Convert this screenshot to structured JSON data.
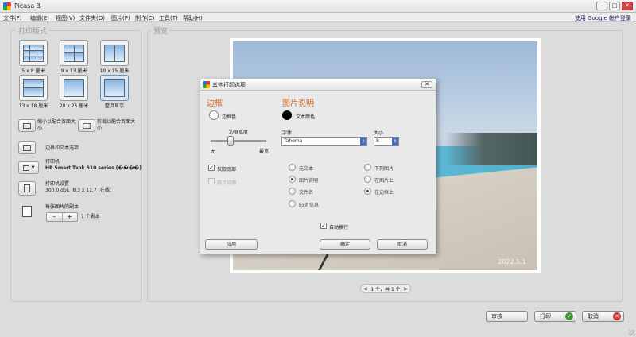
{
  "app": {
    "title": "Picasa 3"
  },
  "window_controls": {
    "minimize": "–",
    "maximize": "□",
    "close": "✕"
  },
  "menu": {
    "items": [
      "文件(F)",
      "编辑(E)",
      "视图(V)",
      "文件夹(O)",
      "图片(P)",
      "制作(C)",
      "工具(T)",
      "帮助(H)"
    ],
    "signin": "使用 Google 帐户登录"
  },
  "left": {
    "section_title": "打印版式",
    "layouts": [
      {
        "label": "5 x 8 厘米"
      },
      {
        "label": "9 x 13 厘米"
      },
      {
        "label": "10 x 15 厘米"
      },
      {
        "label": "13 x 18 厘米"
      },
      {
        "label": "20 x 25 厘米"
      },
      {
        "label": "整页显示"
      }
    ],
    "fit": {
      "shrink_label": "缩小以配合页面大小",
      "crop_label": "剪裁以配合页面大小"
    },
    "border_text": "边界和文本选项",
    "printer": {
      "title": "打印机",
      "name": "HP Smart Tank 510 series (����)"
    },
    "printer_settings": {
      "title": "打印机设置",
      "detail": "300.0 dpi、8.3 x 11.7 (在线)"
    },
    "copies": {
      "title": "每张图片的副本",
      "minus": "–",
      "plus": "+",
      "count_text": "1 个副本"
    }
  },
  "preview": {
    "section_title": "预览",
    "watermark": "2022.5.1",
    "pager_text": "1 个，共 1 个",
    "prev": "◀",
    "next": "▶"
  },
  "dialog": {
    "title": "其他打印选项",
    "close": "✕",
    "border": {
      "heading": "边框",
      "color_label": "边框色",
      "width_label": "边框宽度",
      "min_label": "无",
      "max_label": "最宽",
      "width_fraction": 0.3
    },
    "caption": {
      "heading": "图片说明",
      "text_color_label": "文本颜色",
      "font_label": "字体",
      "font_value": "Tahoma",
      "size_label": "大小",
      "size_value": "8"
    },
    "only_bottom": {
      "label": "仅限底部",
      "checked": true
    },
    "match_caption": {
      "label": "符合说明",
      "checked": false
    },
    "text_options": [
      {
        "label": "无文本",
        "selected": false
      },
      {
        "label": "图片说明",
        "selected": true
      },
      {
        "label": "文件名",
        "selected": false
      },
      {
        "label": "Exif 信息",
        "selected": false
      }
    ],
    "position_options": [
      {
        "label": "下列图片",
        "selected": false
      },
      {
        "label": "在图片上",
        "selected": false
      },
      {
        "label": "在边框上",
        "selected": true
      }
    ],
    "wrap": {
      "label": "自动换行",
      "checked": true
    },
    "buttons": {
      "apply": "应用",
      "ok": "确定",
      "cancel": "取消"
    }
  },
  "bottom": {
    "review": "审核",
    "print": "打印",
    "cancel": "取消"
  },
  "colors": {
    "border_color": "#ffffff",
    "text_color": "#000000",
    "accent": "#d06b2a"
  }
}
